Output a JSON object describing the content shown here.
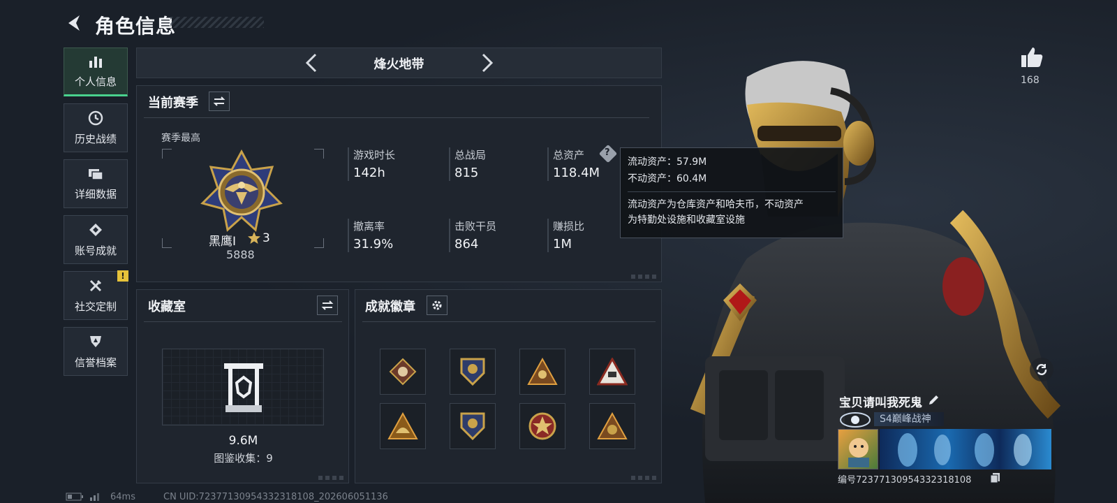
{
  "header": {
    "title": "角色信息"
  },
  "sidebar": {
    "items": [
      {
        "label": "个人信息",
        "icon": "bar-chart-icon",
        "active": true
      },
      {
        "label": "历史战绩",
        "icon": "clock-icon"
      },
      {
        "label": "详细数据",
        "icon": "folders-icon"
      },
      {
        "label": "账号成就",
        "icon": "achievement-icon"
      },
      {
        "label": "社交定制",
        "icon": "tools-icon",
        "badge": "!"
      },
      {
        "label": "信誉档案",
        "icon": "shield-icon"
      }
    ]
  },
  "mode": {
    "title": "烽火地带"
  },
  "season": {
    "title": "当前赛季",
    "best_label": "赛季最高",
    "rank_name": "黑鹰I",
    "rank_stars": "3",
    "rank_score": "5888",
    "stats": [
      {
        "label": "游戏时长",
        "value": "142h"
      },
      {
        "label": "总战局",
        "value": "815"
      },
      {
        "label": "总资产",
        "value": "118.4M"
      },
      {
        "label": "撤离率",
        "value": "31.9%"
      },
      {
        "label": "击败干员",
        "value": "864"
      },
      {
        "label": "赚损比",
        "value": "1M"
      }
    ]
  },
  "tooltip": {
    "liquid": "流动资产：57.9M",
    "fixed": "不动资产：60.4M",
    "desc1": "流动资产为仓库资产和哈夫币，不动资产",
    "desc2": "为特勤处设施和收藏室设施"
  },
  "collection": {
    "title": "收藏室",
    "value": "9.6M",
    "count_label": "图鉴收集：9"
  },
  "achievements": {
    "title": "成就徽章"
  },
  "character": {
    "likes": "168",
    "name": "宝贝请叫我死鬼",
    "title_tag": "S4巅峰战神",
    "id_text": "编号7237713095433231810​8"
  },
  "footer": {
    "ping": "64ms",
    "uid": "CN UID:7237713095433231810​8_202606051136"
  },
  "colors": {
    "accent": "#49d28d",
    "gold": "#c9a24a",
    "warning": "#e6c23a"
  }
}
